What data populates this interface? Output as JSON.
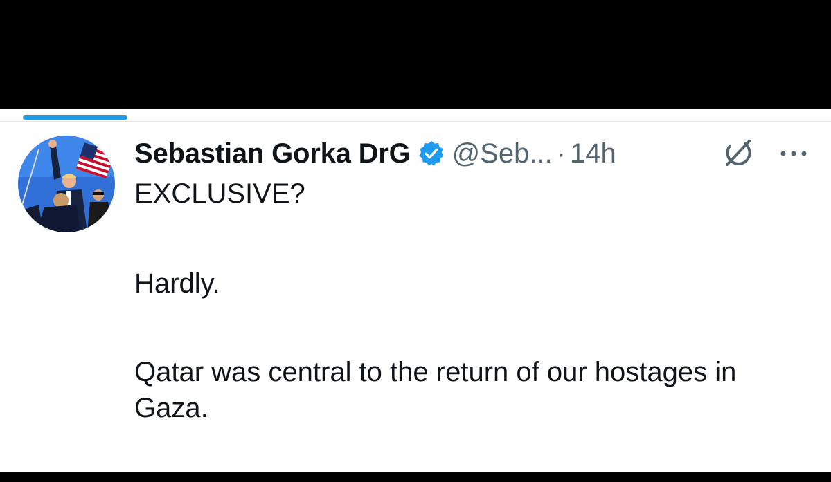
{
  "tweet": {
    "display_name": "Sebastian Gorka DrG",
    "handle": "@Seb...",
    "separator": "·",
    "timestamp": "14h",
    "paragraphs": [
      "EXCLUSIVE?",
      "Hardly.",
      "Qatar was central to the return of our hostages in Gaza."
    ]
  },
  "icons": {
    "avatar": "profile-photo",
    "verified": "verified-badge-icon",
    "grok": "grok-icon",
    "more": "more-options-icon"
  },
  "colors": {
    "accent": "#1d9bf0",
    "text_primary": "#0f1419",
    "text_secondary": "#536471",
    "background": "#ffffff",
    "frame": "#000000"
  }
}
